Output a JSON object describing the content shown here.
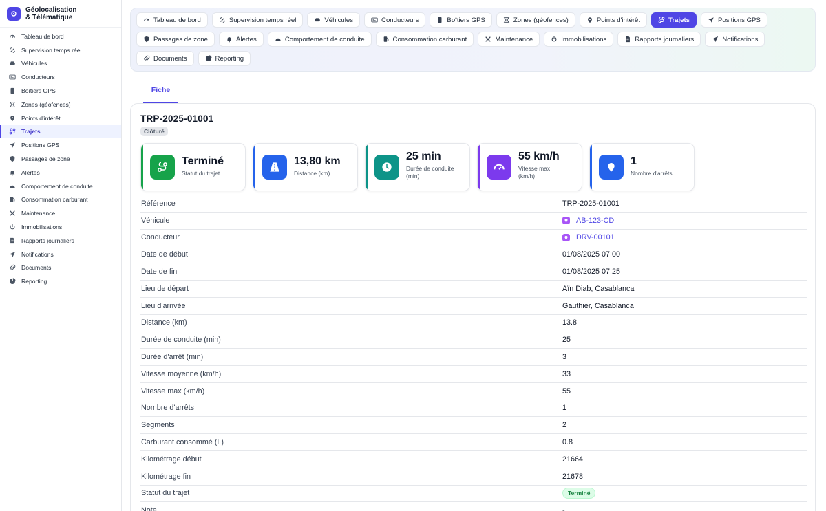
{
  "brand": {
    "title": "Géolocalisation\n& Télématique"
  },
  "sidebar": {
    "items": [
      {
        "label": "Tableau de bord",
        "icon": "dashboard-icon"
      },
      {
        "label": "Supervision temps réel",
        "icon": "satellite-icon"
      },
      {
        "label": "Véhicules",
        "icon": "car-icon"
      },
      {
        "label": "Conducteurs",
        "icon": "id-card-icon"
      },
      {
        "label": "Boîtiers GPS",
        "icon": "device-icon"
      },
      {
        "label": "Zones (géofences)",
        "icon": "geofence-icon"
      },
      {
        "label": "Points d'intérêt",
        "icon": "pin-icon"
      },
      {
        "label": "Trajets",
        "icon": "route-icon",
        "active": true
      },
      {
        "label": "Positions GPS",
        "icon": "navigation-icon"
      },
      {
        "label": "Passages de zone",
        "icon": "shield-icon"
      },
      {
        "label": "Alertes",
        "icon": "bell-icon"
      },
      {
        "label": "Comportement de conduite",
        "icon": "gauge-icon"
      },
      {
        "label": "Consommation carburant",
        "icon": "fuel-icon"
      },
      {
        "label": "Maintenance",
        "icon": "tools-icon"
      },
      {
        "label": "Immobilisations",
        "icon": "power-icon"
      },
      {
        "label": "Rapports journaliers",
        "icon": "report-icon"
      },
      {
        "label": "Notifications",
        "icon": "send-icon"
      },
      {
        "label": "Documents",
        "icon": "paperclip-icon"
      },
      {
        "label": "Reporting",
        "icon": "pie-chart-icon"
      }
    ]
  },
  "topnav": {
    "row1": [
      {
        "label": "Tableau de bord",
        "icon": "dashboard-icon"
      },
      {
        "label": "Supervision temps réel",
        "icon": "satellite-icon"
      },
      {
        "label": "Véhicules",
        "icon": "car-icon"
      },
      {
        "label": "Conducteurs",
        "icon": "id-card-icon"
      },
      {
        "label": "Boîtiers GPS",
        "icon": "device-icon"
      },
      {
        "label": "Zones (géofences)",
        "icon": "geofence-icon"
      },
      {
        "label": "Points d'intérêt",
        "icon": "pin-icon"
      },
      {
        "label": "Trajets",
        "icon": "route-icon",
        "active": true
      },
      {
        "label": "Positions GPS",
        "icon": "navigation-icon"
      }
    ],
    "row2": [
      {
        "label": "Passages de zone",
        "icon": "shield-icon"
      },
      {
        "label": "Alertes",
        "icon": "bell-icon"
      },
      {
        "label": "Comportement de conduite",
        "icon": "gauge-icon"
      },
      {
        "label": "Consommation carburant",
        "icon": "fuel-icon"
      },
      {
        "label": "Maintenance",
        "icon": "tools-icon"
      },
      {
        "label": "Immobilisations",
        "icon": "power-icon"
      },
      {
        "label": "Rapports journaliers",
        "icon": "report-icon"
      },
      {
        "label": "Notifications",
        "icon": "send-icon"
      }
    ],
    "row3": [
      {
        "label": "Documents",
        "icon": "paperclip-icon"
      },
      {
        "label": "Reporting",
        "icon": "pie-chart-icon"
      }
    ]
  },
  "tabs": {
    "fiche": "Fiche"
  },
  "record": {
    "title": "TRP-2025-01001",
    "status": "Clôturé"
  },
  "kpis": [
    {
      "value": "Terminé",
      "label": "Statut du trajet",
      "icon": "route-icon",
      "color": "#16a34a"
    },
    {
      "value": "13,80 km",
      "label": "Distance (km)",
      "icon": "road-icon",
      "color": "#2563eb"
    },
    {
      "value": "25 min",
      "label": "Durée de conduite (min)",
      "icon": "clock-icon",
      "color": "#0d9488"
    },
    {
      "value": "55 km/h",
      "label": "Vitesse max (km/h)",
      "icon": "speedometer-icon",
      "color": "#7c3aed"
    },
    {
      "value": "1",
      "label": "Nombre d'arrêts",
      "icon": "pin-icon",
      "color": "#2563eb"
    }
  ],
  "details": [
    {
      "label": "Référence",
      "value": "TRP-2025-01001"
    },
    {
      "label": "Véhicule",
      "value": "AB-123-CD",
      "link": true
    },
    {
      "label": "Conducteur",
      "value": "DRV-00101",
      "link": true
    },
    {
      "label": "Date de début",
      "value": "01/08/2025 07:00"
    },
    {
      "label": "Date de fin",
      "value": "01/08/2025 07:25"
    },
    {
      "label": "Lieu de départ",
      "value": "Aïn Diab, Casablanca"
    },
    {
      "label": "Lieu d'arrivée",
      "value": "Gauthier, Casablanca"
    },
    {
      "label": "Distance (km)",
      "value": "13.8"
    },
    {
      "label": "Durée de conduite (min)",
      "value": "25"
    },
    {
      "label": "Durée d'arrêt (min)",
      "value": "3"
    },
    {
      "label": "Vitesse moyenne (km/h)",
      "value": "33"
    },
    {
      "label": "Vitesse max (km/h)",
      "value": "55"
    },
    {
      "label": "Nombre d'arrêts",
      "value": "1"
    },
    {
      "label": "Segments",
      "value": "2"
    },
    {
      "label": "Carburant consommé (L)",
      "value": "0.8"
    },
    {
      "label": "Kilométrage début",
      "value": "21664"
    },
    {
      "label": "Kilométrage fin",
      "value": "21678"
    },
    {
      "label": "Statut du trajet",
      "value": "Terminé",
      "badge": true
    },
    {
      "label": "Note",
      "value": "-"
    }
  ],
  "colors": {
    "accent": "#4f46e5",
    "success": "#16a34a"
  }
}
